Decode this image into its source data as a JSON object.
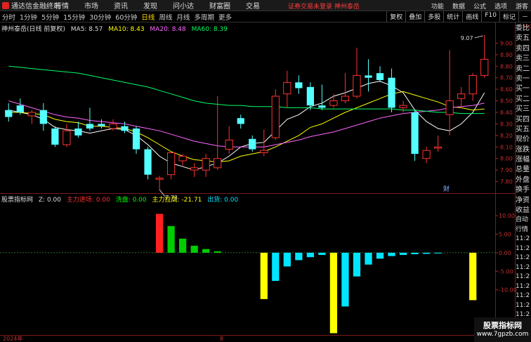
{
  "topbar": {
    "app_title": "通达信金融终端",
    "menu": [
      "行情",
      "市场",
      "资讯",
      "发现",
      "问小达",
      "财富圈",
      "交易"
    ],
    "warning": "证券交易未登录  神州泰岳",
    "right_items": [
      "功能",
      "数据",
      "公式",
      "选项",
      "游客"
    ]
  },
  "periods": [
    "分时",
    "1分钟",
    "5分钟",
    "15分钟",
    "30分钟",
    "60分钟",
    "日线",
    "周线",
    "月线",
    "多周期",
    "更多"
  ],
  "active_period": "日线",
  "tools": [
    "复权",
    "叠加",
    "多股",
    "统计",
    "画线",
    "F10",
    "标记",
    "－"
  ],
  "info": {
    "name": "神州泰岳(日线 前复权)",
    "ma5": "MA5: 8.57",
    "ma10": "MA10: 8.43",
    "ma20": "MA20: 8.48",
    "ma60": "MA60: 8.39",
    "colors": {
      "ma5": "#ffffff",
      "ma10": "#ffff00",
      "ma20": "#ff66ff",
      "ma60": "#00ff66"
    }
  },
  "sub_indicator": {
    "name": "股票指标网",
    "z": "Z: 0.00",
    "zl": "主力进场: 0.00",
    "xp": "洗盘: 0.00",
    "zlgg": "主力拉高: -21.71",
    "ch": "出货: 0.00"
  },
  "right_panel": [
    "委比",
    "卖五",
    "卖四",
    "卖三",
    "卖二",
    "卖一",
    "买一",
    "买二",
    "买三",
    "买四",
    "买五",
    "现价",
    "涨跌",
    "涨幅",
    "总量",
    "外盘",
    "换手",
    "净资",
    "收益"
  ],
  "right_panel2": [
    "自动",
    "行情",
    "11:2",
    "11:2",
    "11:2",
    "11:2",
    "11:2",
    "11:2",
    "11:2",
    "11:2",
    "11:2",
    "11:2"
  ],
  "price_axis": [
    "9.00",
    "8.90",
    "8.80",
    "8.70",
    "8.60",
    "8.50",
    "8.40",
    "8.30",
    "8.20",
    "8.10",
    "8.00",
    "7.90",
    "7.80"
  ],
  "sub_axis": [
    "10.00",
    "5.00",
    "0.00",
    "-5.00",
    "-10.00"
  ],
  "date_axis": {
    "year": "2024年",
    "month": "8"
  },
  "annotations": {
    "high": "9.07",
    "low": "7.73",
    "cai": "财",
    "top_right": "500"
  },
  "watermark": {
    "line1": "股票指标网",
    "line2": "www.7gpzb.com"
  },
  "chart_data": {
    "type": "candlestick",
    "ylim": [
      7.7,
      9.1
    ],
    "candles": [
      {
        "o": 8.42,
        "c": 8.36,
        "h": 8.48,
        "l": 8.32
      },
      {
        "o": 8.46,
        "c": 8.4,
        "h": 8.52,
        "l": 8.38
      },
      {
        "o": 8.37,
        "c": 8.4,
        "h": 8.42,
        "l": 8.3
      },
      {
        "o": 8.42,
        "c": 8.3,
        "h": 8.48,
        "l": 8.24
      },
      {
        "o": 8.26,
        "c": 8.12,
        "h": 8.28,
        "l": 8.1
      },
      {
        "o": 8.12,
        "c": 8.24,
        "h": 8.3,
        "l": 8.1
      },
      {
        "o": 8.26,
        "c": 8.2,
        "h": 8.32,
        "l": 8.18
      },
      {
        "o": 8.3,
        "c": 8.26,
        "h": 8.44,
        "l": 8.24
      },
      {
        "o": 8.3,
        "c": 8.28,
        "h": 8.34,
        "l": 8.26
      },
      {
        "o": 8.26,
        "c": 8.3,
        "h": 8.34,
        "l": 8.24
      },
      {
        "o": 8.28,
        "c": 8.24,
        "h": 8.32,
        "l": 8.22
      },
      {
        "o": 8.26,
        "c": 8.08,
        "h": 8.28,
        "l": 8.04
      },
      {
        "o": 8.08,
        "c": 7.86,
        "h": 8.1,
        "l": 7.82
      },
      {
        "o": 7.82,
        "c": 7.83,
        "h": 7.85,
        "l": 7.73
      },
      {
        "o": 7.86,
        "c": 8.05,
        "h": 8.06,
        "l": 7.82
      },
      {
        "o": 7.98,
        "c": 8.02,
        "h": 8.04,
        "l": 7.94
      },
      {
        "o": 7.9,
        "c": 7.92,
        "h": 7.96,
        "l": 7.84
      },
      {
        "o": 7.9,
        "c": 8.0,
        "h": 8.04,
        "l": 7.84
      },
      {
        "o": 7.92,
        "c": 8.0,
        "h": 8.54,
        "l": 7.9
      },
      {
        "o": 8.08,
        "c": 8.16,
        "h": 8.28,
        "l": 8.04
      },
      {
        "o": 8.35,
        "c": 8.3,
        "h": 8.38,
        "l": 8.26
      },
      {
        "o": 8.17,
        "c": 8.08,
        "h": 8.2,
        "l": 8.06
      },
      {
        "o": 8.05,
        "c": 8.07,
        "h": 8.25,
        "l": 8.02
      },
      {
        "o": 8.18,
        "c": 8.54,
        "h": 8.6,
        "l": 8.16
      },
      {
        "o": 8.56,
        "c": 8.66,
        "h": 8.76,
        "l": 8.44
      },
      {
        "o": 8.66,
        "c": 8.61,
        "h": 8.72,
        "l": 8.56
      },
      {
        "o": 8.62,
        "c": 8.46,
        "h": 8.66,
        "l": 8.42
      },
      {
        "o": 8.46,
        "c": 8.44,
        "h": 8.64,
        "l": 8.42
      },
      {
        "o": 8.46,
        "c": 8.5,
        "h": 8.56,
        "l": 8.44
      },
      {
        "o": 8.5,
        "c": 8.54,
        "h": 8.74,
        "l": 8.48
      },
      {
        "o": 8.54,
        "c": 8.72,
        "h": 8.96,
        "l": 8.52
      },
      {
        "o": 8.72,
        "c": 8.7,
        "h": 8.86,
        "l": 8.58
      },
      {
        "o": 8.74,
        "c": 8.68,
        "h": 8.8,
        "l": 8.66
      },
      {
        "o": 8.7,
        "c": 8.44,
        "h": 8.78,
        "l": 8.4
      },
      {
        "o": 8.44,
        "c": 8.46,
        "h": 8.5,
        "l": 8.4
      },
      {
        "o": 8.4,
        "c": 8.04,
        "h": 8.42,
        "l": 7.98
      },
      {
        "o": 8.0,
        "c": 8.07,
        "h": 8.1,
        "l": 7.96
      },
      {
        "o": 8.09,
        "c": 8.1,
        "h": 8.2,
        "l": 8.06
      },
      {
        "o": 8.38,
        "c": 8.5,
        "h": 8.94,
        "l": 8.2
      },
      {
        "o": 8.52,
        "c": 8.56,
        "h": 8.62,
        "l": 8.44
      },
      {
        "o": 8.56,
        "c": 8.72,
        "h": 8.74,
        "l": 8.5
      },
      {
        "o": 8.72,
        "c": 8.86,
        "h": 9.07,
        "l": 8.7
      }
    ],
    "ma_series": [
      {
        "name": "MA5",
        "color": "#ffffff",
        "values": [
          8.42,
          8.4,
          8.38,
          8.34,
          8.27,
          8.25,
          8.24,
          8.22,
          8.24,
          8.26,
          8.25,
          8.2,
          8.12,
          8.02,
          7.96,
          7.93,
          7.9,
          7.93,
          7.96,
          8.02,
          8.1,
          8.13,
          8.14,
          8.24,
          8.34,
          8.38,
          8.45,
          8.48,
          8.54,
          8.57,
          8.61,
          8.65,
          8.67,
          8.63,
          8.57,
          8.42,
          8.32,
          8.26,
          8.24,
          8.3,
          8.4,
          8.57
        ]
      },
      {
        "name": "MA10",
        "color": "#ffff00",
        "values": [
          8.4,
          8.4,
          8.39,
          8.38,
          8.34,
          8.32,
          8.31,
          8.28,
          8.28,
          8.27,
          8.26,
          8.23,
          8.18,
          8.12,
          8.06,
          8.02,
          7.99,
          7.98,
          7.97,
          7.98,
          8.02,
          8.04,
          8.06,
          8.1,
          8.15,
          8.2,
          8.27,
          8.3,
          8.35,
          8.4,
          8.44,
          8.48,
          8.52,
          8.56,
          8.58,
          8.55,
          8.52,
          8.49,
          8.45,
          8.44,
          8.42,
          8.43
        ]
      },
      {
        "name": "MA20",
        "color": "#ff66ff",
        "values": [
          8.5,
          8.47,
          8.44,
          8.41,
          8.38,
          8.36,
          8.35,
          8.33,
          8.32,
          8.31,
          8.3,
          8.28,
          8.26,
          8.24,
          8.21,
          8.18,
          8.15,
          8.13,
          8.11,
          8.1,
          8.1,
          8.1,
          8.1,
          8.12,
          8.14,
          8.16,
          8.19,
          8.21,
          8.23,
          8.26,
          8.29,
          8.32,
          8.35,
          8.37,
          8.39,
          8.4,
          8.41,
          8.42,
          8.44,
          8.45,
          8.46,
          8.48
        ]
      },
      {
        "name": "MA60",
        "color": "#00ff66",
        "values": [
          8.8,
          8.79,
          8.78,
          8.77,
          8.76,
          8.75,
          8.74,
          8.72,
          8.7,
          8.68,
          8.66,
          8.64,
          8.62,
          8.59,
          8.56,
          8.53,
          8.5,
          8.48,
          8.47,
          8.46,
          8.46,
          8.45,
          8.45,
          8.45,
          8.44,
          8.44,
          8.44,
          8.43,
          8.43,
          8.43,
          8.43,
          8.43,
          8.43,
          8.43,
          8.42,
          8.42,
          8.41,
          8.4,
          8.4,
          8.39,
          8.39,
          8.39
        ]
      }
    ],
    "sub_bars": [
      {
        "i": 13,
        "v": 10.5,
        "color": "#ff2020"
      },
      {
        "i": 14,
        "v": 7.2,
        "color": "#00cc00"
      },
      {
        "i": 15,
        "v": 3.8,
        "color": "#00cc00"
      },
      {
        "i": 16,
        "v": 1.9,
        "color": "#00cc00"
      },
      {
        "i": 17,
        "v": 1.0,
        "color": "#00cc00"
      },
      {
        "i": 18,
        "v": 0.4,
        "color": "#00cc00"
      },
      {
        "i": 22,
        "v": -12.5,
        "color": "#ffff00"
      },
      {
        "i": 23,
        "v": -7.6,
        "color": "#00e5ff"
      },
      {
        "i": 24,
        "v": -3.7,
        "color": "#00e5ff"
      },
      {
        "i": 25,
        "v": -2.0,
        "color": "#00e5ff"
      },
      {
        "i": 26,
        "v": -1.2,
        "color": "#00e5ff"
      },
      {
        "i": 27,
        "v": -0.6,
        "color": "#00e5ff"
      },
      {
        "i": 28,
        "v": -21.71,
        "color": "#ffff00"
      },
      {
        "i": 29,
        "v": -14.5,
        "color": "#00e5ff"
      },
      {
        "i": 30,
        "v": -6.4,
        "color": "#00e5ff"
      },
      {
        "i": 31,
        "v": -3.2,
        "color": "#00e5ff"
      },
      {
        "i": 32,
        "v": -1.6,
        "color": "#00e5ff"
      },
      {
        "i": 33,
        "v": -0.9,
        "color": "#00e5ff"
      },
      {
        "i": 34,
        "v": -0.6,
        "color": "#00e5ff"
      },
      {
        "i": 35,
        "v": -0.4,
        "color": "#00e5ff"
      },
      {
        "i": 36,
        "v": -0.3,
        "color": "#00e5ff"
      },
      {
        "i": 37,
        "v": -0.2,
        "color": "#00e5ff"
      },
      {
        "i": 40,
        "v": -12.8,
        "color": "#ffff00"
      }
    ],
    "sub_ylim": [
      -22,
      14
    ]
  }
}
